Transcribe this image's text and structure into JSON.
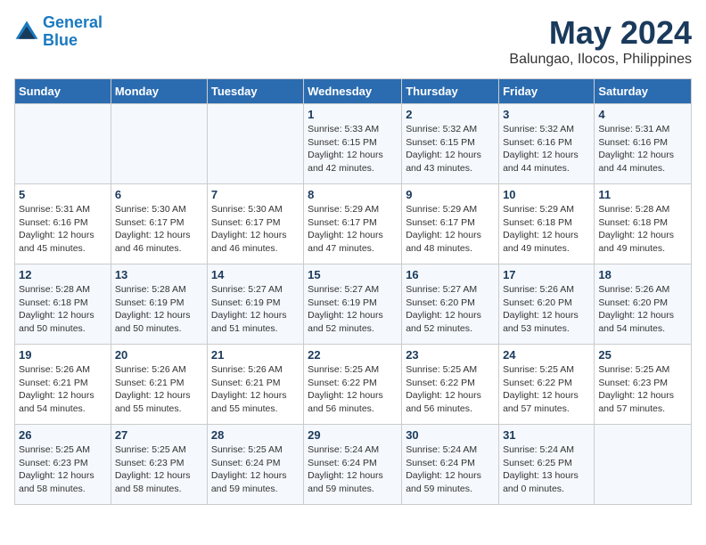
{
  "header": {
    "logo_line1": "General",
    "logo_line2": "Blue",
    "title": "May 2024",
    "subtitle": "Balungao, Ilocos, Philippines"
  },
  "days_of_week": [
    "Sunday",
    "Monday",
    "Tuesday",
    "Wednesday",
    "Thursday",
    "Friday",
    "Saturday"
  ],
  "weeks": [
    [
      {
        "day": "",
        "info": ""
      },
      {
        "day": "",
        "info": ""
      },
      {
        "day": "",
        "info": ""
      },
      {
        "day": "1",
        "info": "Sunrise: 5:33 AM\nSunset: 6:15 PM\nDaylight: 12 hours\nand 42 minutes."
      },
      {
        "day": "2",
        "info": "Sunrise: 5:32 AM\nSunset: 6:15 PM\nDaylight: 12 hours\nand 43 minutes."
      },
      {
        "day": "3",
        "info": "Sunrise: 5:32 AM\nSunset: 6:16 PM\nDaylight: 12 hours\nand 44 minutes."
      },
      {
        "day": "4",
        "info": "Sunrise: 5:31 AM\nSunset: 6:16 PM\nDaylight: 12 hours\nand 44 minutes."
      }
    ],
    [
      {
        "day": "5",
        "info": "Sunrise: 5:31 AM\nSunset: 6:16 PM\nDaylight: 12 hours\nand 45 minutes."
      },
      {
        "day": "6",
        "info": "Sunrise: 5:30 AM\nSunset: 6:17 PM\nDaylight: 12 hours\nand 46 minutes."
      },
      {
        "day": "7",
        "info": "Sunrise: 5:30 AM\nSunset: 6:17 PM\nDaylight: 12 hours\nand 46 minutes."
      },
      {
        "day": "8",
        "info": "Sunrise: 5:29 AM\nSunset: 6:17 PM\nDaylight: 12 hours\nand 47 minutes."
      },
      {
        "day": "9",
        "info": "Sunrise: 5:29 AM\nSunset: 6:17 PM\nDaylight: 12 hours\nand 48 minutes."
      },
      {
        "day": "10",
        "info": "Sunrise: 5:29 AM\nSunset: 6:18 PM\nDaylight: 12 hours\nand 49 minutes."
      },
      {
        "day": "11",
        "info": "Sunrise: 5:28 AM\nSunset: 6:18 PM\nDaylight: 12 hours\nand 49 minutes."
      }
    ],
    [
      {
        "day": "12",
        "info": "Sunrise: 5:28 AM\nSunset: 6:18 PM\nDaylight: 12 hours\nand 50 minutes."
      },
      {
        "day": "13",
        "info": "Sunrise: 5:28 AM\nSunset: 6:19 PM\nDaylight: 12 hours\nand 50 minutes."
      },
      {
        "day": "14",
        "info": "Sunrise: 5:27 AM\nSunset: 6:19 PM\nDaylight: 12 hours\nand 51 minutes."
      },
      {
        "day": "15",
        "info": "Sunrise: 5:27 AM\nSunset: 6:19 PM\nDaylight: 12 hours\nand 52 minutes."
      },
      {
        "day": "16",
        "info": "Sunrise: 5:27 AM\nSunset: 6:20 PM\nDaylight: 12 hours\nand 52 minutes."
      },
      {
        "day": "17",
        "info": "Sunrise: 5:26 AM\nSunset: 6:20 PM\nDaylight: 12 hours\nand 53 minutes."
      },
      {
        "day": "18",
        "info": "Sunrise: 5:26 AM\nSunset: 6:20 PM\nDaylight: 12 hours\nand 54 minutes."
      }
    ],
    [
      {
        "day": "19",
        "info": "Sunrise: 5:26 AM\nSunset: 6:21 PM\nDaylight: 12 hours\nand 54 minutes."
      },
      {
        "day": "20",
        "info": "Sunrise: 5:26 AM\nSunset: 6:21 PM\nDaylight: 12 hours\nand 55 minutes."
      },
      {
        "day": "21",
        "info": "Sunrise: 5:26 AM\nSunset: 6:21 PM\nDaylight: 12 hours\nand 55 minutes."
      },
      {
        "day": "22",
        "info": "Sunrise: 5:25 AM\nSunset: 6:22 PM\nDaylight: 12 hours\nand 56 minutes."
      },
      {
        "day": "23",
        "info": "Sunrise: 5:25 AM\nSunset: 6:22 PM\nDaylight: 12 hours\nand 56 minutes."
      },
      {
        "day": "24",
        "info": "Sunrise: 5:25 AM\nSunset: 6:22 PM\nDaylight: 12 hours\nand 57 minutes."
      },
      {
        "day": "25",
        "info": "Sunrise: 5:25 AM\nSunset: 6:23 PM\nDaylight: 12 hours\nand 57 minutes."
      }
    ],
    [
      {
        "day": "26",
        "info": "Sunrise: 5:25 AM\nSunset: 6:23 PM\nDaylight: 12 hours\nand 58 minutes."
      },
      {
        "day": "27",
        "info": "Sunrise: 5:25 AM\nSunset: 6:23 PM\nDaylight: 12 hours\nand 58 minutes."
      },
      {
        "day": "28",
        "info": "Sunrise: 5:25 AM\nSunset: 6:24 PM\nDaylight: 12 hours\nand 59 minutes."
      },
      {
        "day": "29",
        "info": "Sunrise: 5:24 AM\nSunset: 6:24 PM\nDaylight: 12 hours\nand 59 minutes."
      },
      {
        "day": "30",
        "info": "Sunrise: 5:24 AM\nSunset: 6:24 PM\nDaylight: 12 hours\nand 59 minutes."
      },
      {
        "day": "31",
        "info": "Sunrise: 5:24 AM\nSunset: 6:25 PM\nDaylight: 13 hours\nand 0 minutes."
      },
      {
        "day": "",
        "info": ""
      }
    ]
  ]
}
